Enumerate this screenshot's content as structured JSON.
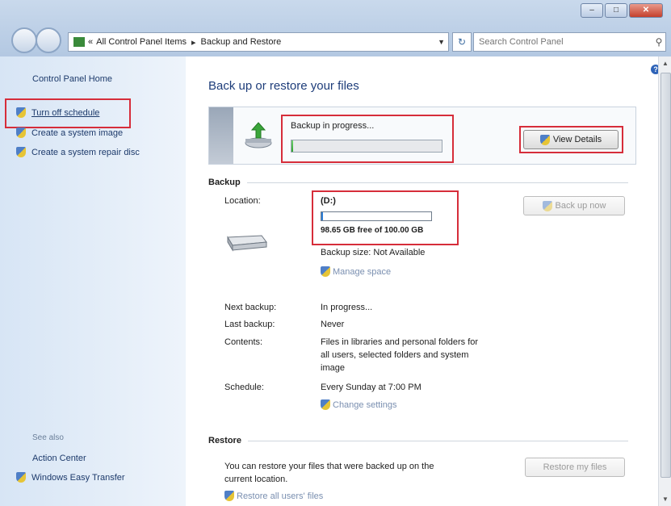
{
  "window": {
    "buttons": {
      "minimize": "–",
      "maximize": "□",
      "close": "✕"
    }
  },
  "address": {
    "crumbs": [
      "All Control Panel Items",
      "Backup and Restore"
    ],
    "sep": "▸",
    "prefix": "«",
    "dropdown": "▼"
  },
  "search": {
    "placeholder": "Search Control Panel",
    "icon": "magnifier-icon"
  },
  "refresh": "↻",
  "help": "?",
  "left": {
    "home": "Control Panel Home",
    "tasks": [
      "Turn off schedule",
      "Create a system image",
      "Create a system repair disc"
    ],
    "see_also_title": "See also",
    "see_also": [
      "Action Center",
      "Windows Easy Transfer"
    ]
  },
  "main": {
    "title": "Back up or restore your files",
    "status": {
      "text": "Backup in progress...",
      "progress": 0.01,
      "view_details": "View Details"
    },
    "backup": {
      "heading": "Backup",
      "location_label": "Location:",
      "drive": "(D:)",
      "drive_used": 0.0135,
      "free": "98.65 GB free of 100.00 GB",
      "size": "Backup size: Not Available",
      "manage": "Manage space",
      "back_up_now": "Back up now",
      "next_label": "Next backup:",
      "next_value": "In progress...",
      "last_label": "Last backup:",
      "last_value": "Never",
      "contents_label": "Contents:",
      "contents_value": [
        "Files in libraries and personal folders for",
        "all users, selected folders and system",
        "image"
      ],
      "schedule_label": "Schedule:",
      "schedule_value": "Every Sunday at 7:00 PM",
      "change": "Change settings"
    },
    "restore": {
      "heading": "Restore",
      "text": [
        "You can restore your files that were backed up on the",
        "current location."
      ],
      "restore_button": "Restore my files",
      "restore_all": "Restore all users' files"
    }
  },
  "colors": {
    "highlight": "#d62d3a",
    "link": "#1d3a6b",
    "progress": "#2fa52f"
  }
}
